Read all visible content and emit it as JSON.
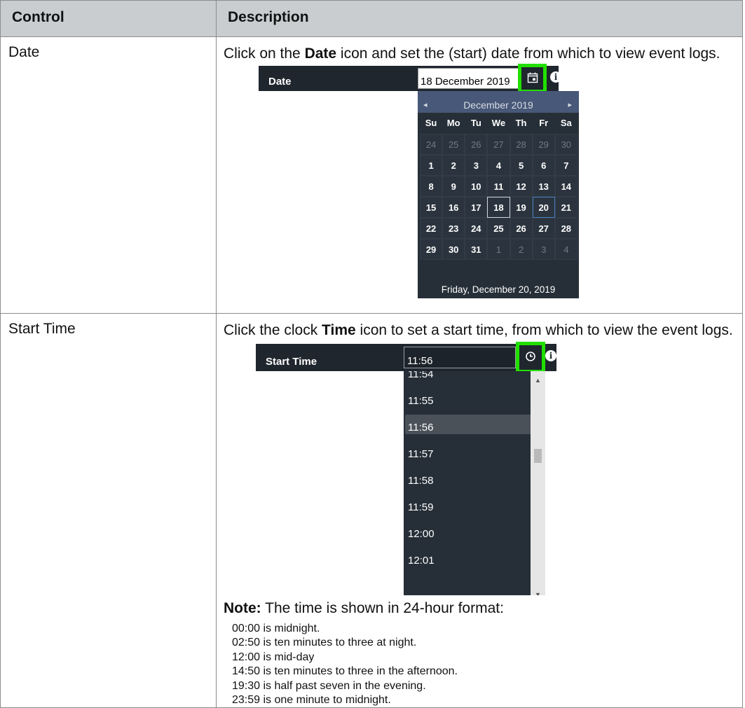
{
  "table": {
    "header": {
      "control": "Control",
      "description": "Description"
    },
    "rows": [
      {
        "control": "Date",
        "desc_before": "Click on the ",
        "desc_bold": "Date",
        "desc_after": " icon and set the (start) date from which to view event logs.",
        "screenshot": {
          "bar_label": "Date",
          "input_value": "18 December 2019",
          "icon": "calendar-icon",
          "calendar": {
            "month_label": "December 2019",
            "prev_icon": "◂",
            "next_icon": "▸",
            "weekdays": [
              "Su",
              "Mo",
              "Tu",
              "We",
              "Th",
              "Fr",
              "Sa"
            ],
            "weeks": [
              [
                "24",
                "25",
                "26",
                "27",
                "28",
                "29",
                "30"
              ],
              [
                "1",
                "2",
                "3",
                "4",
                "5",
                "6",
                "7"
              ],
              [
                "8",
                "9",
                "10",
                "11",
                "12",
                "13",
                "14"
              ],
              [
                "15",
                "16",
                "17",
                "18",
                "19",
                "20",
                "21"
              ],
              [
                "22",
                "23",
                "24",
                "25",
                "26",
                "27",
                "28"
              ],
              [
                "29",
                "30",
                "31",
                "1",
                "2",
                "3",
                "4"
              ]
            ],
            "selected_day": "18",
            "today_day": "20",
            "footer": "Friday, December 20, 2019"
          }
        }
      },
      {
        "control": "Start Time",
        "desc_before": "Click the clock ",
        "desc_bold": "Time",
        "desc_after": " icon to set a start time, from which to view the event logs.",
        "screenshot": {
          "bar_label": "Start Time",
          "input_value": "11:56",
          "icon": "clock-icon",
          "list_items": [
            "11:54",
            "11:55",
            "11:56",
            "11:57",
            "11:58",
            "11:59",
            "12:00",
            "12:01"
          ],
          "active_item": "11:56"
        },
        "note": {
          "label": "Note:",
          "text": " The time is shown in 24-hour format:",
          "items": [
            "00:00 is midnight.",
            "02:50 is ten minutes to three at night.",
            "12:00 is mid-day",
            "14:50 is ten minutes to three in the afternoon.",
            "19:30 is half past seven in the evening.",
            "23:59 is one minute to midnight."
          ]
        }
      }
    ]
  },
  "colors": {
    "header_bg": "#c9cdd0",
    "highlight": "#21e000",
    "panel_bg": "#1f262e",
    "calendar_head": "#485878"
  }
}
